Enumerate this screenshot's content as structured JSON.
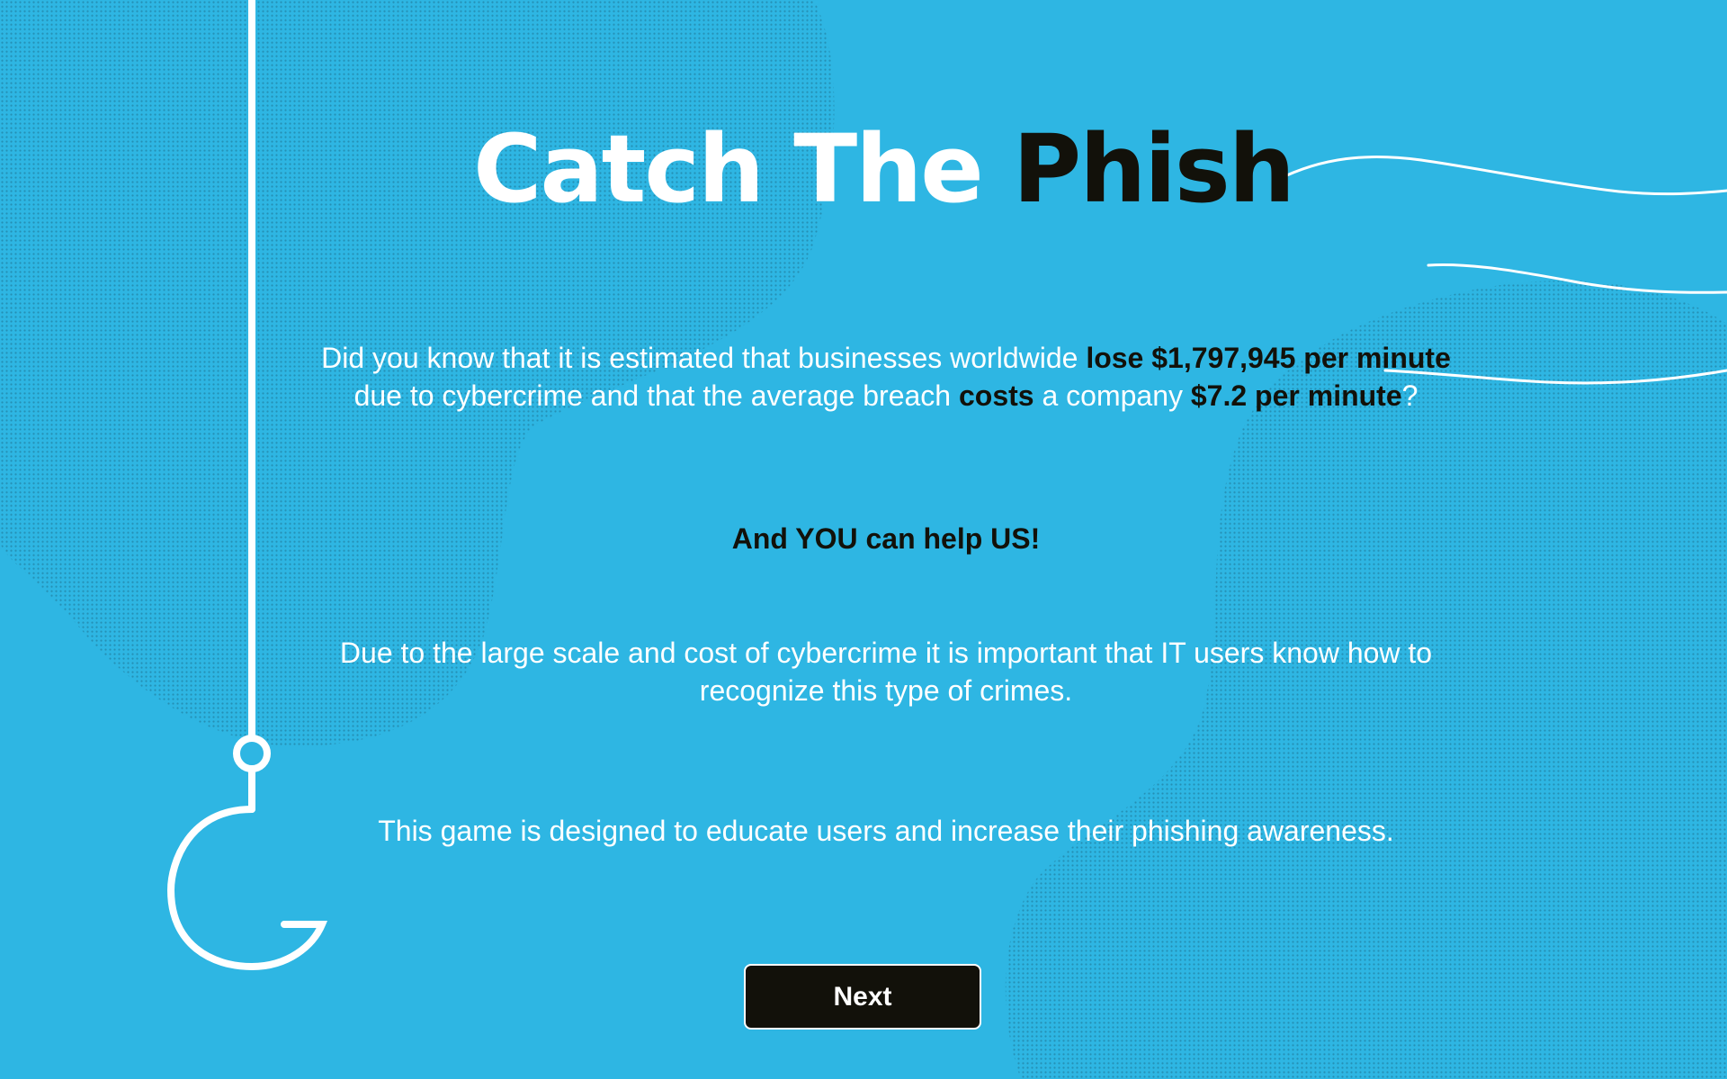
{
  "title": {
    "part1": "Catch The",
    "part2": "Phish"
  },
  "intro": {
    "t1": "Did you know that it is estimated that businesses worldwide ",
    "b1": "lose $1,797,945 per minute",
    "t2": " due to cybercrime and that the average breach ",
    "b2": "costs",
    "t3": " a company ",
    "b3": "$7.2 per minute",
    "t4": "?"
  },
  "help_text": "And YOU can help US!",
  "scale_text": "Due to the large scale and cost of cybercrime it is important that IT users know how to recognize this type of crimes.",
  "purpose_text": "This game is designed to educate users and increase their phishing awareness.",
  "next_button": {
    "label": "Next"
  },
  "colors": {
    "background": "#2eb6e3",
    "accent_dark": "#12110a",
    "text_light": "#ffffff"
  },
  "icons": {
    "hook": "fishing-hook-icon",
    "waves": "wave-lines"
  }
}
